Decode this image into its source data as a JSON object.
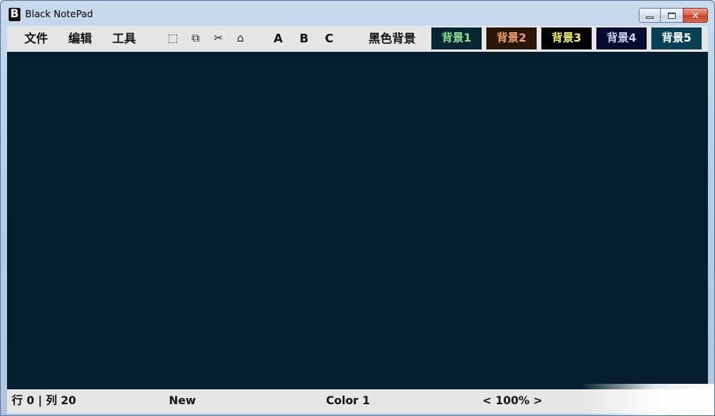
{
  "window": {
    "title": "Black NotePad",
    "logo_letter": "B",
    "buttons": {
      "minimize": "minimize",
      "maximize": "maximize",
      "close": "✕"
    }
  },
  "menu": {
    "items": [
      "文件",
      "编辑",
      "工具"
    ]
  },
  "tools": {
    "select_all_icon": "select-all-icon",
    "copy_icon": "copy-icon",
    "cut_icon": "scissors-icon",
    "paste_icon": "paste-icon",
    "select_all_glyph": "⬚",
    "copy_glyph": "⧉",
    "cut_glyph": "✂",
    "paste_glyph": "⌂"
  },
  "fonts": {
    "a": "A",
    "b": "B",
    "c": "C"
  },
  "background": {
    "black_label": "黑色背景",
    "presets": [
      {
        "label": "背景1",
        "bg": "#082634",
        "fg": "#8fe08f"
      },
      {
        "label": "背景2",
        "bg": "#2a1608",
        "fg": "#f0a070"
      },
      {
        "label": "背景3",
        "bg": "#000000",
        "fg": "#f4f06a"
      },
      {
        "label": "背景4",
        "bg": "#080a30",
        "fg": "#c8d0f0"
      },
      {
        "label": "背景5",
        "bg": "#0a4055",
        "fg": "#ffffff"
      }
    ]
  },
  "editor": {
    "content": "",
    "background": "#041e2d"
  },
  "status": {
    "position": "行 0 | 列 20",
    "file_state": "New",
    "color": "Color 1",
    "zoom_left": "<",
    "zoom_value": "100%",
    "zoom_right": ">"
  }
}
